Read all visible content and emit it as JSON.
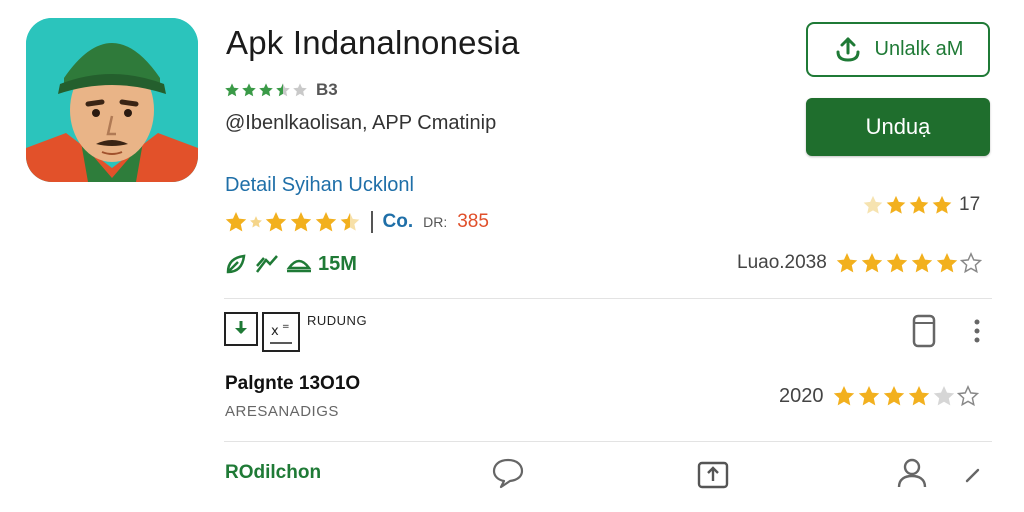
{
  "app": {
    "title": "Apk Indanalnonesia",
    "header_rating_value": 3.5,
    "header_rating_count": "B3",
    "developer": "@Ibenlkaolisan, APP Cmatinip"
  },
  "buttons": {
    "install_outline_label": "Unlalk aM",
    "download_label": "Unduạ"
  },
  "detail": {
    "link_text": "Detail Syihan Ucklonl",
    "right_rating_value": 3.5,
    "right_rating_count": "17",
    "row_rating_value": 4.5,
    "row_rating_badge": "Co.",
    "row_rating_prefix": "DR:",
    "row_rating_number": "385",
    "stats_size": "15M",
    "date_text": "Luao.2038",
    "date_rating_value": 5
  },
  "item": {
    "tag_label": "RUDUNG",
    "title": "Palgnte 13O1O",
    "subtitle": "ARESANADIGS",
    "year": "2020",
    "rating_value": 4
  },
  "bottom": {
    "label": "ROdilchon"
  },
  "colors": {
    "accent_green": "#1f6e2d",
    "star_gold": "#f2b01e",
    "link_blue": "#1f6fa8",
    "rating_orange": "#e04f2a"
  },
  "icons": {
    "app_icon": "soldier-portrait-icon",
    "install": "download-arrow-icon",
    "device": "phone-device-icon",
    "more": "more-vertical-icon",
    "comment": "comment-bubble-icon",
    "share": "share-upload-icon",
    "person": "person-icon",
    "edit": "pencil-icon"
  }
}
